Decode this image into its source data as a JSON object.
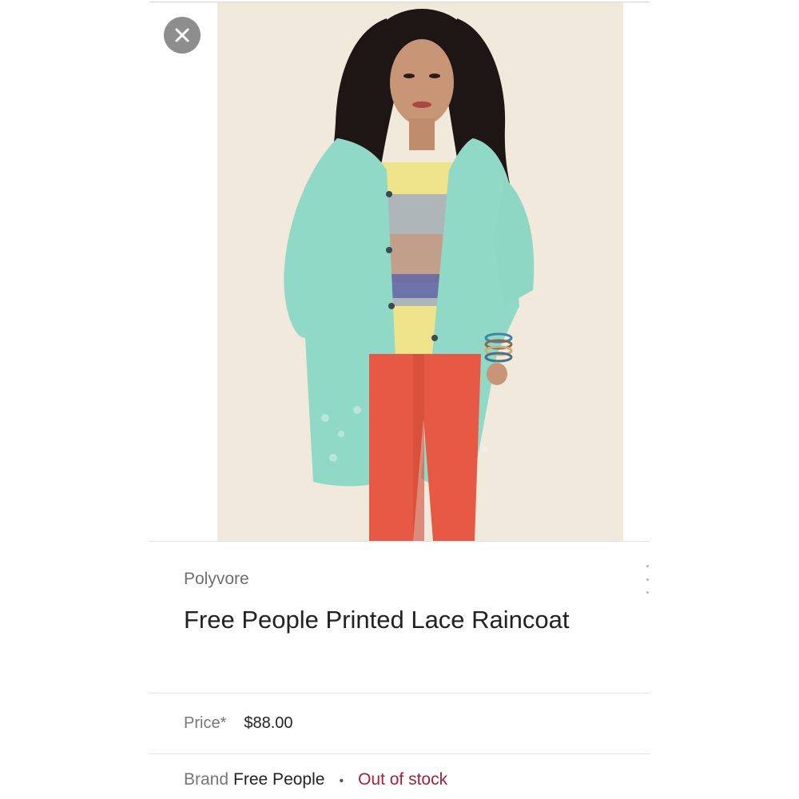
{
  "product": {
    "source": "Polyvore",
    "title": "Free People Printed Lace Raincoat",
    "price_label": "Price*",
    "price_value": "$88.00",
    "brand_label": "Brand",
    "brand_value": "Free People",
    "separator": "•",
    "stock_status": "Out of stock"
  },
  "icons": {
    "close": "close-icon",
    "more": "more-vert-icon"
  },
  "colors": {
    "stock_status": "#a1223a",
    "close_button_bg": "#8e8e8e"
  }
}
